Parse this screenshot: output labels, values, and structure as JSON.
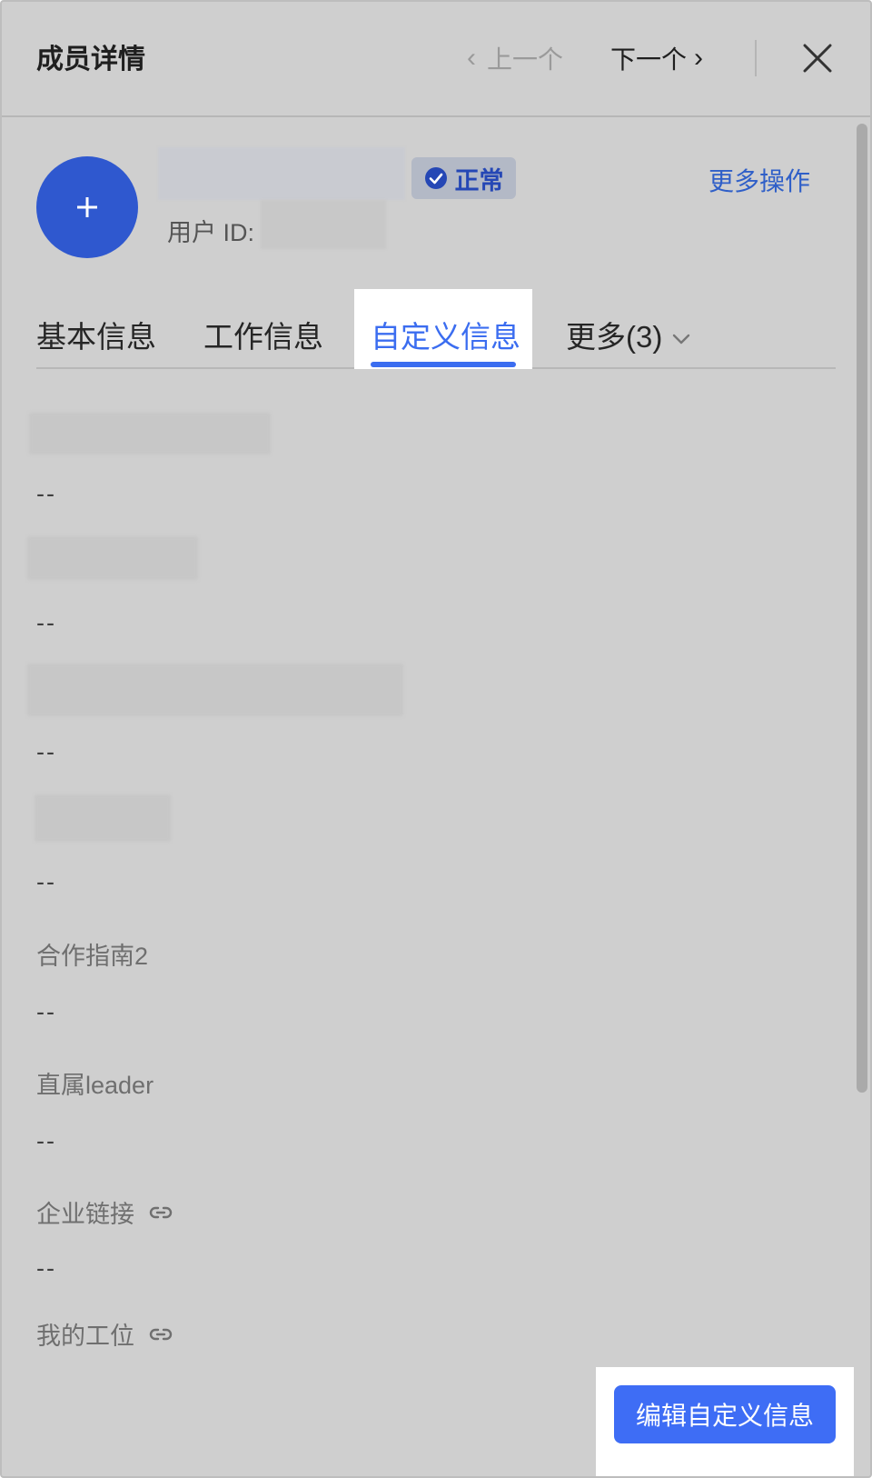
{
  "header": {
    "title": "成员详情",
    "prev_label": "上一个",
    "next_label": "下一个"
  },
  "profile": {
    "status": "正常",
    "uid_label": "用户 ID:",
    "more_actions": "更多操作"
  },
  "tabs": [
    {
      "label": "基本信息"
    },
    {
      "label": "工作信息"
    },
    {
      "label": "自定义信息"
    },
    {
      "label": "更多(3)"
    }
  ],
  "fields": {
    "values": [
      "--",
      "--",
      "--",
      "--",
      "--",
      "--",
      "--"
    ],
    "labels": [
      "合作指南2",
      "直属leader",
      "企业链接",
      "我的工位"
    ]
  },
  "edit_button": "编辑自定义信息",
  "colors": {
    "accent": "#3b6df0",
    "avatar": "#2f58cf",
    "status_text": "#2547b5",
    "overlay": "#cfcfcf"
  }
}
